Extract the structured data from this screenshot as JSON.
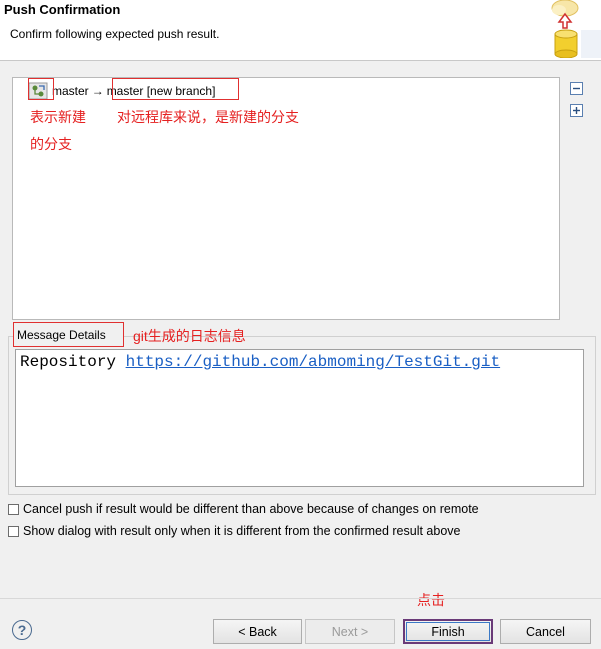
{
  "header": {
    "title": "Push Confirmation",
    "subtitle": "Confirm following expected push result."
  },
  "tree": {
    "source_ref": "master",
    "arrow": "→",
    "target_ref": "master [new branch]"
  },
  "annotations": {
    "new_branch_line1": "表示新建",
    "new_branch_line2": "的分支",
    "remote_note": "对远程库来说，是新建的分支",
    "log_note": "git生成的日志信息",
    "click_note": "点击"
  },
  "message_details": {
    "label": "Message Details",
    "repo_prefix": "Repository ",
    "repo_url": "https://github.com/abmoming/TestGit.git"
  },
  "options": {
    "cancel_push_label": "Cancel push if result would be different than above because of changes on remote",
    "show_dialog_label": "Show dialog with result only when it is different from the confirmed result above",
    "cancel_push_checked": false,
    "show_dialog_checked": false
  },
  "buttons": {
    "back": "< Back",
    "next": "Next >",
    "finish": "Finish",
    "cancel": "Cancel",
    "help": "?"
  },
  "icons": {
    "side_collapse": "collapse-all-icon",
    "side_expand": "expand-all-icon",
    "wizard": "git-push-wizard-icon",
    "node": "branch-ref-icon"
  },
  "colors": {
    "annotation_red": "#e52020",
    "link_blue": "#1a5fc4"
  }
}
